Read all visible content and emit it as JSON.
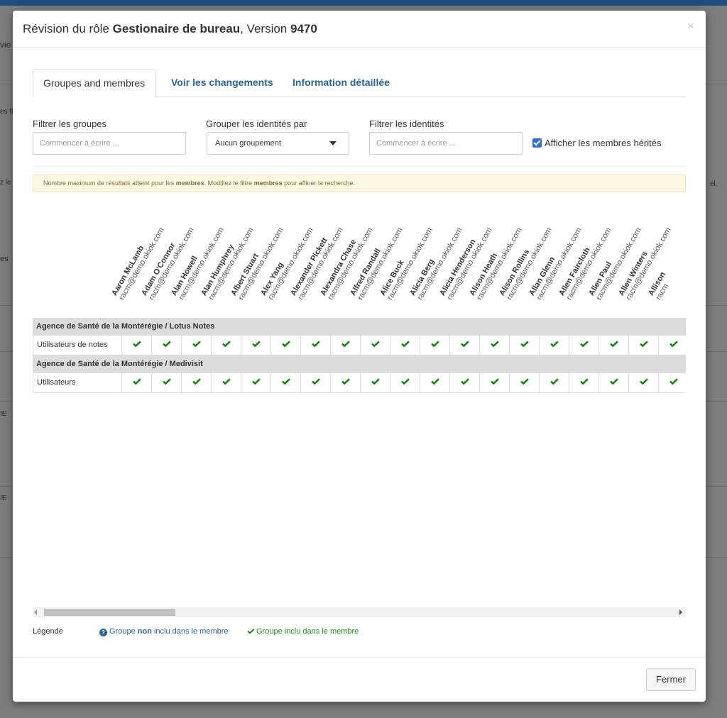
{
  "background": {
    "fragments": [
      "vie",
      "es fi",
      "z le",
      "el.",
      "es",
      "IE",
      "IE"
    ]
  },
  "modal": {
    "title_prefix": "Révision du rôle ",
    "role_name": "Gestionaire de bureau",
    "title_version_prefix": ", Version ",
    "version": "9470",
    "close_glyph": "×"
  },
  "tabs": [
    {
      "label": "Groupes and membres",
      "active": true
    },
    {
      "label": "Voir les changements",
      "active": false
    },
    {
      "label": "Information détaillée",
      "active": false
    }
  ],
  "filters": {
    "groups_label": "Filtrer les groupes",
    "groups_placeholder": "Commencer à écrire ...",
    "group_by_label": "Grouper les identités par",
    "group_by_value": "Aucun groupement",
    "identities_label": "Filtrer les identités",
    "identities_placeholder": "Commencer à écrire ...",
    "inherited_label": "Afficher les membres hérités",
    "inherited_checked": true
  },
  "alert": {
    "text_1": "Nombre maximum de résultats atteint pour les ",
    "bold_1": "membres",
    "text_2": ". Modifiez le filtre ",
    "bold_2": "membres",
    "text_3": " pour affiner la recherche."
  },
  "identities": [
    {
      "name": "Aaron McLamb",
      "email": "racm@demo.okiok.com"
    },
    {
      "name": "Adam O'Connor",
      "email": "racm@demo.okiok.com"
    },
    {
      "name": "Alan Howell",
      "email": "racm@demo.okiok.com"
    },
    {
      "name": "Alan Humphrey",
      "email": "racm@demo.okiok.com"
    },
    {
      "name": "Albert Stuart",
      "email": "racm@demo.okiok.com"
    },
    {
      "name": "Alex Yang",
      "email": "racm@demo.okiok.com"
    },
    {
      "name": "Alexander Pickett",
      "email": "racm@demo.okiok.com"
    },
    {
      "name": "Alexandra Chase",
      "email": "racm@demo.okiok.com"
    },
    {
      "name": "Alfred Randall",
      "email": "racm@demo.okiok.com"
    },
    {
      "name": "Alice Buck",
      "email": "racm@demo.okiok.com"
    },
    {
      "name": "Alicia Berg",
      "email": "racm@demo.okiok.com"
    },
    {
      "name": "Alicia Henderson",
      "email": "racm@demo.okiok.com"
    },
    {
      "name": "Alison Heath",
      "email": "racm@demo.okiok.com"
    },
    {
      "name": "Alison Rollins",
      "email": "racm@demo.okiok.com"
    },
    {
      "name": "Allan Glenn",
      "email": "racm@demo.okiok.com"
    },
    {
      "name": "Allen Faircloth",
      "email": "racm@demo.okiok.com"
    },
    {
      "name": "Allen Paul",
      "email": "racm@demo.okiok.com"
    },
    {
      "name": "Allen Winters",
      "email": "racm@demo.okiok.com"
    },
    {
      "name": "Allison",
      "email": "racm"
    }
  ],
  "groups": [
    {
      "header": "Agence de Santé de la Montérégie / Lotus Notes",
      "row_label": "Utilisateurs de notes",
      "included": [
        true,
        true,
        true,
        true,
        true,
        true,
        true,
        true,
        true,
        true,
        true,
        true,
        true,
        true,
        true,
        true,
        true,
        true,
        true
      ]
    },
    {
      "header": "Agence de Santé de la Montérégie / Medivisit",
      "row_label": "Utilisateurs",
      "included": [
        true,
        true,
        true,
        true,
        true,
        true,
        true,
        true,
        true,
        true,
        true,
        true,
        true,
        true,
        true,
        true,
        true,
        true,
        true
      ]
    }
  ],
  "legend": {
    "label": "Légende",
    "not_included_prefix": "Groupe ",
    "not_included_bold": "non",
    "not_included_suffix": " inclu dans le membre",
    "included_text": "Groupe inclu dans le membre"
  },
  "footer": {
    "close_button": "Fermer"
  },
  "colors": {
    "check_green": "#128212",
    "link_blue": "#2a6496",
    "group_header_bg": "#dcdcdc"
  }
}
